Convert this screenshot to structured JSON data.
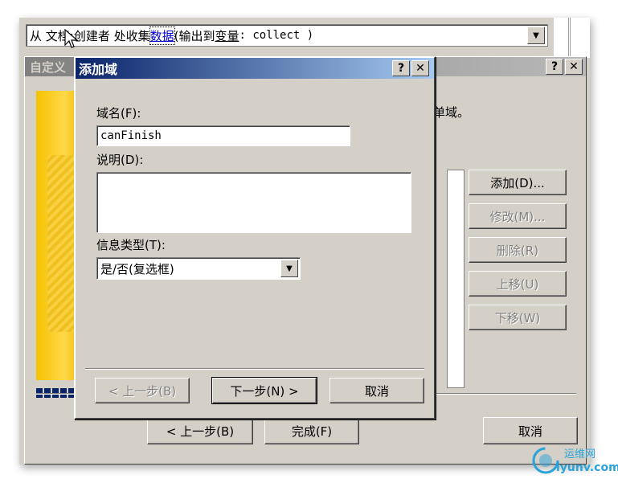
{
  "top_combo": {
    "text_part1": "从 文档:创建者 处收集 ",
    "link_text": "数据",
    "text_part2": " (输出到 ",
    "text_part3": "变量",
    "text_part4": ": collect )"
  },
  "back_dialog": {
    "title": "自定义",
    "help_label": "?",
    "close_label": "✕",
    "desc_tail": "单域。",
    "buttons": {
      "add": "添加(D)...",
      "modify": "修改(M)...",
      "delete": "删除(R)",
      "move_up": "上移(U)",
      "move_down": "下移(W)"
    },
    "nav": {
      "prev": "< 上一步(B)",
      "finish": "完成(F)",
      "cancel": "取消"
    }
  },
  "front_dialog": {
    "title": "添加域",
    "help_label": "?",
    "close_label": "✕",
    "field_name_label": "域名(F):",
    "field_name_value": "canFinish",
    "description_label": "说明(D):",
    "description_value": "",
    "info_type_label": "信息类型(T):",
    "info_type_value": "是/否(复选框)",
    "nav": {
      "prev": "< 上一步(B)",
      "next": "下一步(N) >",
      "cancel": "取消"
    }
  },
  "watermark": {
    "name": "运维网",
    "url": "iyunv.com"
  },
  "colors": {
    "active_title_start": "#0a246a",
    "active_title_end": "#a6caf0",
    "dialog_face": "#d4d0c8",
    "wizard_yellow": "#f5c200"
  }
}
